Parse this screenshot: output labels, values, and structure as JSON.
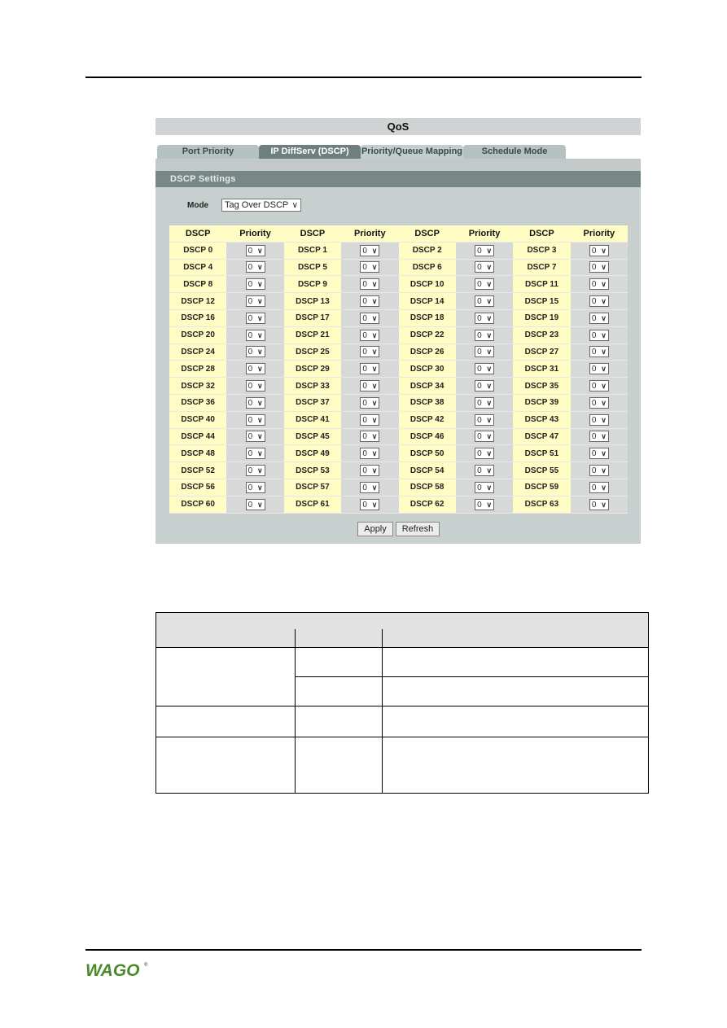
{
  "panel": {
    "title": "QoS",
    "tabs": [
      {
        "label": "Port Priority",
        "active": false
      },
      {
        "label": "IP DiffServ (DSCP)",
        "active": true
      },
      {
        "label": "Priority/Queue Mapping",
        "active": false
      },
      {
        "label": "Schedule Mode",
        "active": false
      }
    ],
    "section_title": "DSCP Settings",
    "mode": {
      "label": "Mode",
      "value": "Tag Over DSCP"
    },
    "grid_headers": [
      "DSCP",
      "Priority",
      "DSCP",
      "Priority",
      "DSCP",
      "Priority",
      "DSCP",
      "Priority"
    ],
    "rows": [
      [
        {
          "dscp": "DSCP 0",
          "priority": "0"
        },
        {
          "dscp": "DSCP 1",
          "priority": "0"
        },
        {
          "dscp": "DSCP 2",
          "priority": "0"
        },
        {
          "dscp": "DSCP 3",
          "priority": "0"
        }
      ],
      [
        {
          "dscp": "DSCP 4",
          "priority": "0"
        },
        {
          "dscp": "DSCP 5",
          "priority": "0"
        },
        {
          "dscp": "DSCP 6",
          "priority": "0"
        },
        {
          "dscp": "DSCP 7",
          "priority": "0"
        }
      ],
      [
        {
          "dscp": "DSCP 8",
          "priority": "0"
        },
        {
          "dscp": "DSCP 9",
          "priority": "0"
        },
        {
          "dscp": "DSCP 10",
          "priority": "0"
        },
        {
          "dscp": "DSCP 11",
          "priority": "0"
        }
      ],
      [
        {
          "dscp": "DSCP 12",
          "priority": "0"
        },
        {
          "dscp": "DSCP 13",
          "priority": "0"
        },
        {
          "dscp": "DSCP 14",
          "priority": "0"
        },
        {
          "dscp": "DSCP 15",
          "priority": "0"
        }
      ],
      [
        {
          "dscp": "DSCP 16",
          "priority": "0"
        },
        {
          "dscp": "DSCP 17",
          "priority": "0"
        },
        {
          "dscp": "DSCP 18",
          "priority": "0"
        },
        {
          "dscp": "DSCP 19",
          "priority": "0"
        }
      ],
      [
        {
          "dscp": "DSCP 20",
          "priority": "0"
        },
        {
          "dscp": "DSCP 21",
          "priority": "0"
        },
        {
          "dscp": "DSCP 22",
          "priority": "0"
        },
        {
          "dscp": "DSCP 23",
          "priority": "0"
        }
      ],
      [
        {
          "dscp": "DSCP 24",
          "priority": "0"
        },
        {
          "dscp": "DSCP 25",
          "priority": "0"
        },
        {
          "dscp": "DSCP 26",
          "priority": "0"
        },
        {
          "dscp": "DSCP 27",
          "priority": "0"
        }
      ],
      [
        {
          "dscp": "DSCP 28",
          "priority": "0"
        },
        {
          "dscp": "DSCP 29",
          "priority": "0"
        },
        {
          "dscp": "DSCP 30",
          "priority": "0"
        },
        {
          "dscp": "DSCP 31",
          "priority": "0"
        }
      ],
      [
        {
          "dscp": "DSCP 32",
          "priority": "0"
        },
        {
          "dscp": "DSCP 33",
          "priority": "0"
        },
        {
          "dscp": "DSCP 34",
          "priority": "0"
        },
        {
          "dscp": "DSCP 35",
          "priority": "0"
        }
      ],
      [
        {
          "dscp": "DSCP 36",
          "priority": "0"
        },
        {
          "dscp": "DSCP 37",
          "priority": "0"
        },
        {
          "dscp": "DSCP 38",
          "priority": "0"
        },
        {
          "dscp": "DSCP 39",
          "priority": "0"
        }
      ],
      [
        {
          "dscp": "DSCP 40",
          "priority": "0"
        },
        {
          "dscp": "DSCP 41",
          "priority": "0"
        },
        {
          "dscp": "DSCP 42",
          "priority": "0"
        },
        {
          "dscp": "DSCP 43",
          "priority": "0"
        }
      ],
      [
        {
          "dscp": "DSCP 44",
          "priority": "0"
        },
        {
          "dscp": "DSCP 45",
          "priority": "0"
        },
        {
          "dscp": "DSCP 46",
          "priority": "0"
        },
        {
          "dscp": "DSCP 47",
          "priority": "0"
        }
      ],
      [
        {
          "dscp": "DSCP 48",
          "priority": "0"
        },
        {
          "dscp": "DSCP 49",
          "priority": "0"
        },
        {
          "dscp": "DSCP 50",
          "priority": "0"
        },
        {
          "dscp": "DSCP 51",
          "priority": "0"
        }
      ],
      [
        {
          "dscp": "DSCP 52",
          "priority": "0"
        },
        {
          "dscp": "DSCP 53",
          "priority": "0"
        },
        {
          "dscp": "DSCP 54",
          "priority": "0"
        },
        {
          "dscp": "DSCP 55",
          "priority": "0"
        }
      ],
      [
        {
          "dscp": "DSCP 56",
          "priority": "0"
        },
        {
          "dscp": "DSCP 57",
          "priority": "0"
        },
        {
          "dscp": "DSCP 58",
          "priority": "0"
        },
        {
          "dscp": "DSCP 59",
          "priority": "0"
        }
      ],
      [
        {
          "dscp": "DSCP 60",
          "priority": "0"
        },
        {
          "dscp": "DSCP 61",
          "priority": "0"
        },
        {
          "dscp": "DSCP 62",
          "priority": "0"
        },
        {
          "dscp": "DSCP 63",
          "priority": "0"
        }
      ]
    ],
    "buttons": {
      "apply": "Apply",
      "refresh": "Refresh"
    }
  },
  "footer": {
    "logo_text": "WAGO",
    "logo_color": "#4a8a2a"
  }
}
